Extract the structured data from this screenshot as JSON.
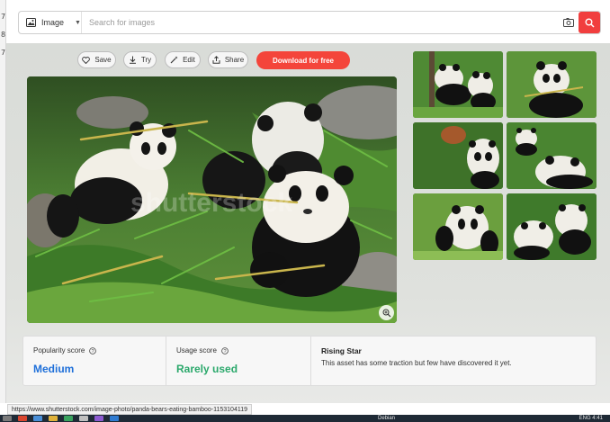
{
  "window": {
    "edge_digits": [
      "7",
      "8",
      "7"
    ]
  },
  "search": {
    "type_label": "Image",
    "placeholder": "Search for images"
  },
  "actions": {
    "save": "Save",
    "try": "Try",
    "edit": "Edit",
    "share": "Share",
    "download": "Download for free"
  },
  "stats": {
    "popularity": {
      "label": "Popularity score",
      "value": "Medium",
      "color": "#1e6fd9"
    },
    "usage": {
      "label": "Usage score",
      "value": "Rarely used",
      "color": "#2aa86b"
    },
    "rising": {
      "title": "Rising Star",
      "description": "This asset has some traction but few have discovered it yet."
    }
  },
  "status_url": "https://www.shutterstock.com/image-photo/panda-bears-eating-bamboo-1153104119",
  "taskbar": {
    "app_label": "Debian",
    "clock": "ENG  4:41"
  },
  "colors": {
    "accent": "#f13e3e",
    "download": "#f4453b"
  }
}
